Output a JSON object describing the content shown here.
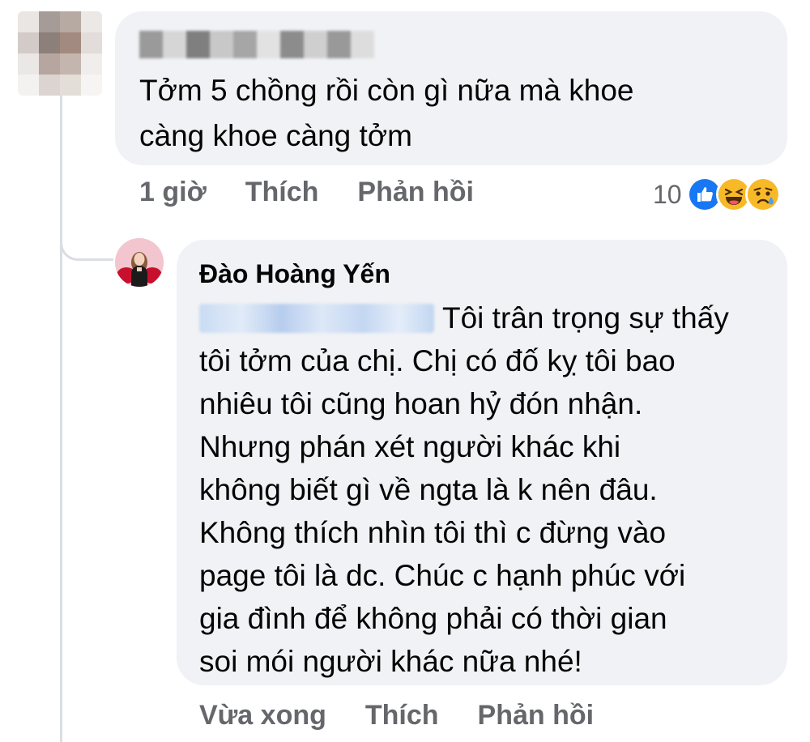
{
  "comment": {
    "text_line1": "Tởm 5 chồng rồi còn gì nữa mà khoe",
    "text_line2": "càng khoe càng tởm",
    "time": "1 giờ",
    "like_label": "Thích",
    "reply_label": "Phản hồi",
    "reaction_count": "10",
    "reactions": [
      "like-reaction-icon",
      "haha-reaction-icon",
      "sad-reaction-icon"
    ]
  },
  "reply": {
    "author": "Đào Hoàng Yến",
    "lines": [
      "Tôi trân trọng sự thấy",
      "tôi tởm của chị. Chị có đố kỵ tôi bao",
      "nhiêu tôi cũng hoan hỷ đón nhận.",
      "Nhưng phán xét người khác khi",
      "không biết gì về ngta là k nên đâu.",
      "Không thích nhìn tôi thì c đừng vào",
      "page tôi là dc. Chúc c hạnh phúc với",
      "gia đình để không phải có thời gian",
      "soi mói người khác nữa nhé!"
    ],
    "time": "Vừa xong",
    "like_label": "Thích",
    "reply_label": "Phản hồi"
  },
  "colors": {
    "bubble": "#f0f2f5",
    "text": "#050505",
    "meta": "#65676b",
    "like_blue": "#1877f2",
    "haha_yellow": "#f7b928"
  }
}
